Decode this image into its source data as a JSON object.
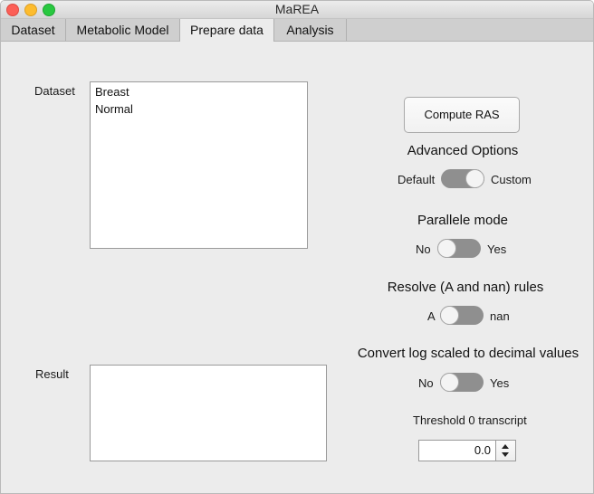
{
  "window": {
    "title": "MaREA"
  },
  "tabs": [
    {
      "label": "Dataset"
    },
    {
      "label": "Metabolic Model"
    },
    {
      "label": "Prepare data",
      "active": true
    },
    {
      "label": "Analysis"
    }
  ],
  "dataset": {
    "label": "Dataset",
    "items": [
      "Breast",
      "Normal"
    ]
  },
  "result": {
    "label": "Result"
  },
  "compute_button": "Compute RAS",
  "advanced_options": {
    "heading": "Advanced Options",
    "left": "Default",
    "right": "Custom",
    "state": "right"
  },
  "parallel_mode": {
    "heading": "Parallele mode",
    "left": "No",
    "right": "Yes",
    "state": "left"
  },
  "resolve_rules": {
    "heading": "Resolve (A and nan) rules",
    "left": "A",
    "right": "nan",
    "state": "left"
  },
  "convert_log": {
    "heading": "Convert log scaled to decimal values",
    "left": "No",
    "right": "Yes",
    "state": "left"
  },
  "threshold": {
    "label": "Threshold 0 transcript",
    "value": "0.0"
  },
  "colors": {
    "toggle_track": "#8f8f8f",
    "window_bg": "#ececec",
    "tab_bg": "#cfcfcf"
  }
}
